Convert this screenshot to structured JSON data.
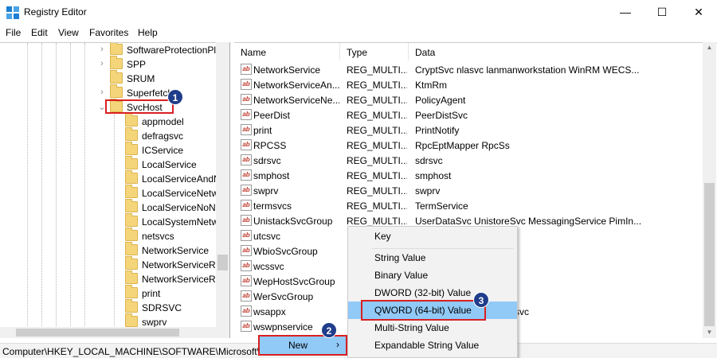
{
  "window": {
    "title": "Registry Editor",
    "controls": {
      "minimize": "—",
      "maximize": "☐",
      "close": "✕"
    }
  },
  "menubar": [
    "File",
    "Edit",
    "View",
    "Favorites",
    "Help"
  ],
  "tree": {
    "items": [
      {
        "label": "SoftwareProtectionPl",
        "expander": "›"
      },
      {
        "label": "SPP",
        "expander": "›"
      },
      {
        "label": "SRUM",
        "expander": ""
      },
      {
        "label": "Superfetch",
        "expander": "›"
      },
      {
        "label": "SvcHost",
        "expander": "⌄",
        "selected": true
      },
      {
        "label": "appmodel"
      },
      {
        "label": "defragsvc"
      },
      {
        "label": "ICService"
      },
      {
        "label": "LocalService"
      },
      {
        "label": "LocalServiceAndN"
      },
      {
        "label": "LocalServiceNetw"
      },
      {
        "label": "LocalServiceNoNe"
      },
      {
        "label": "LocalSystemNetw"
      },
      {
        "label": "netsvcs"
      },
      {
        "label": "NetworkService"
      },
      {
        "label": "NetworkServiceRe"
      },
      {
        "label": "NetworkServiceRe"
      },
      {
        "label": "print"
      },
      {
        "label": "SDRSVC"
      },
      {
        "label": "swprv"
      }
    ]
  },
  "list": {
    "columns": {
      "name": "Name",
      "type": "Type",
      "data": "Data"
    },
    "rows": [
      {
        "name": "NetworkService",
        "type": "REG_MULTI...",
        "data": "CryptSvc nlasvc lanmanworkstation WinRM WECS..."
      },
      {
        "name": "NetworkServiceAn...",
        "type": "REG_MULTI...",
        "data": "KtmRm"
      },
      {
        "name": "NetworkServiceNe...",
        "type": "REG_MULTI...",
        "data": "PolicyAgent"
      },
      {
        "name": "PeerDist",
        "type": "REG_MULTI...",
        "data": "PeerDistSvc"
      },
      {
        "name": "print",
        "type": "REG_MULTI...",
        "data": "PrintNotify"
      },
      {
        "name": "RPCSS",
        "type": "REG_MULTI...",
        "data": "RpcEptMapper RpcSs"
      },
      {
        "name": "sdrsvc",
        "type": "REG_MULTI...",
        "data": "sdrsvc"
      },
      {
        "name": "smphost",
        "type": "REG_MULTI...",
        "data": "smphost"
      },
      {
        "name": "swprv",
        "type": "REG_MULTI...",
        "data": "swprv"
      },
      {
        "name": "termsvcs",
        "type": "REG_MULTI...",
        "data": "TermService"
      },
      {
        "name": "UnistackSvcGroup",
        "type": "REG_MULTI...",
        "data": "UserDataSvc UnistoreSvc MessagingService PimIn..."
      },
      {
        "name": "utcsvc",
        "type": "",
        "data": ""
      },
      {
        "name": "WbioSvcGroup",
        "type": "",
        "data": ""
      },
      {
        "name": "wcssvc",
        "type": "",
        "data": ""
      },
      {
        "name": "WepHostSvcGroup",
        "type": "",
        "data": ""
      },
      {
        "name": "WerSvcGroup",
        "type": "",
        "data": ""
      },
      {
        "name": "wsappx",
        "type": "",
        "data": "svc"
      },
      {
        "name": "wswpnservice",
        "type": "",
        "data": ""
      }
    ],
    "icon_text": "ab"
  },
  "context_menu": {
    "new_label": "New",
    "new_arrow": "›",
    "submenu": {
      "key": "Key",
      "items": [
        "String Value",
        "Binary Value",
        "DWORD (32-bit) Value",
        "QWORD (64-bit) Value",
        "Multi-String Value",
        "Expandable String Value"
      ]
    }
  },
  "statusbar": {
    "path": "Computer\\HKEY_LOCAL_MACHINE\\SOFTWARE\\Microsoft\\W"
  },
  "badges": [
    "1",
    "2",
    "3"
  ],
  "colors": {
    "highlight": "#91c9f7",
    "annotation_red": "#d92020",
    "badge": "#1f3d8a",
    "folder": "#f5d57a"
  }
}
